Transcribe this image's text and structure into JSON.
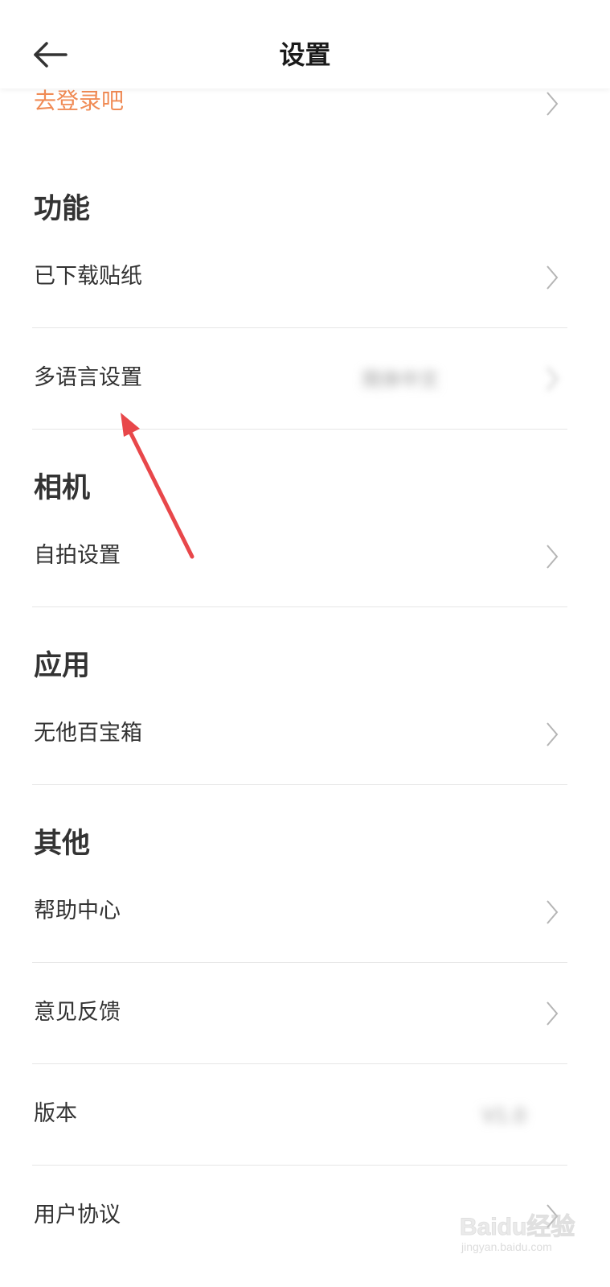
{
  "header": {
    "title": "设置",
    "back_icon": "arrow-left-icon"
  },
  "login": {
    "label": "去登录吧",
    "color": "#f08b55"
  },
  "sections": [
    {
      "title": "功能",
      "items": [
        {
          "label": "已下载贴纸",
          "icon": "chevron-right-icon"
        },
        {
          "label": "多语言设置",
          "value": "简体中文",
          "icon": "chevron-right-icon"
        }
      ]
    },
    {
      "title": "相机",
      "items": [
        {
          "label": "自拍设置",
          "icon": "chevron-right-icon"
        }
      ]
    },
    {
      "title": "应用",
      "items": [
        {
          "label": "无他百宝箱",
          "icon": "chevron-right-icon"
        }
      ]
    },
    {
      "title": "其他",
      "items": [
        {
          "label": "帮助中心",
          "icon": "chevron-right-icon"
        },
        {
          "label": "意见反馈",
          "icon": "chevron-right-icon"
        },
        {
          "label": "版本",
          "value": "V1.0"
        },
        {
          "label": "用户协议",
          "icon": "chevron-right-icon"
        }
      ]
    }
  ],
  "annotation": {
    "icon": "red-arrow-annotation",
    "color": "#e8474a"
  },
  "watermark": {
    "brand": "Baidu经验",
    "url": "jingyan.baidu.com"
  }
}
